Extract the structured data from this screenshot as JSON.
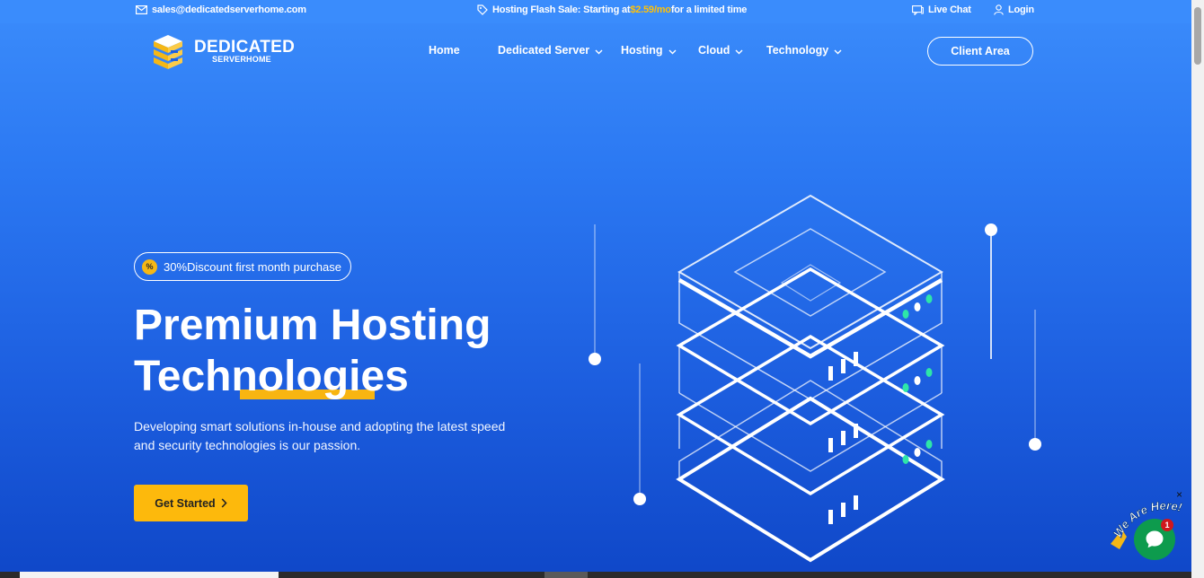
{
  "topbar": {
    "email": "sales@dedicatedserverhome.com",
    "sale_prefix": "Hosting Flash Sale: Starting at",
    "sale_price": "$2.59/mo",
    "sale_suffix": "for a limited time",
    "live_chat": "Live Chat",
    "login": "Login"
  },
  "logo": {
    "line1": "DEDICATED",
    "line2": "SERVERHOME"
  },
  "nav": {
    "items": [
      {
        "label": "Home",
        "dropdown": false
      },
      {
        "label": "Dedicated Server",
        "dropdown": true
      },
      {
        "label": "Hosting",
        "dropdown": true
      },
      {
        "label": "Cloud",
        "dropdown": true
      },
      {
        "label": "Technology",
        "dropdown": true
      }
    ],
    "client_area": "Client Area"
  },
  "hero": {
    "badge_icon": "%",
    "discount": "30%Discount first month purchase",
    "title_line1": "Premium Hosting",
    "title_line2": "Technologies",
    "description": "Developing smart solutions in-house and adopting the latest speed and security technologies is our passion.",
    "cta": "Get Started"
  },
  "chat": {
    "label": "We Are Here!",
    "count": "1",
    "close": "×"
  },
  "colors": {
    "accent": "#fdb90c",
    "primary": "#1d5fe0",
    "chat": "#0d9b4d"
  }
}
